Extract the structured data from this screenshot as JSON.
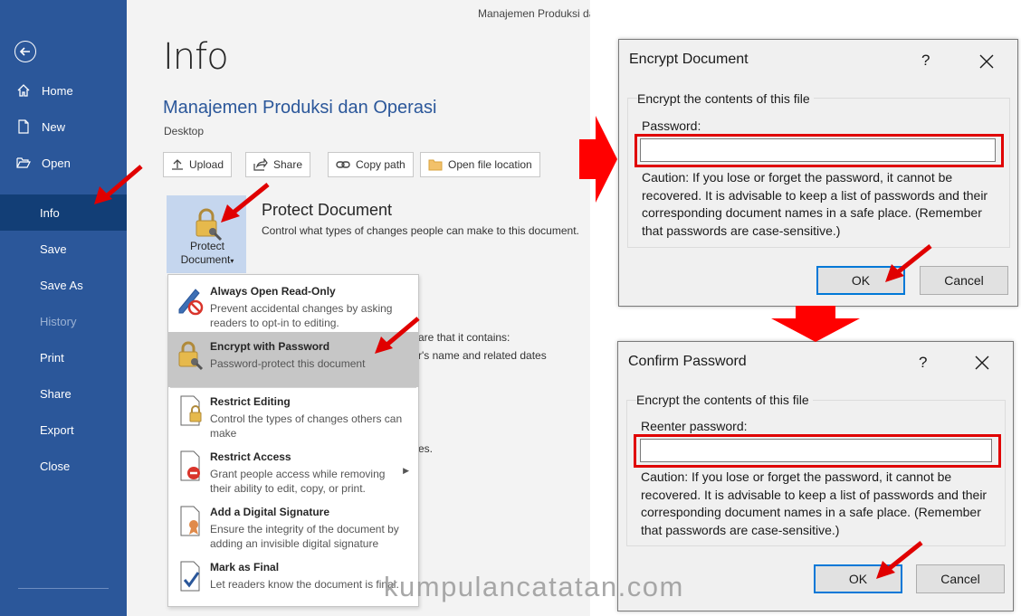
{
  "window": {
    "title": "Manajemen Produksi da"
  },
  "sidebar": {
    "items": [
      {
        "label": "Home",
        "icon": "home-icon"
      },
      {
        "label": "New",
        "icon": "new-document-icon"
      },
      {
        "label": "Open",
        "icon": "folder-open-icon"
      },
      {
        "label": "Info",
        "active": true
      },
      {
        "label": "Save"
      },
      {
        "label": "Save As"
      },
      {
        "label": "History",
        "disabled": true
      },
      {
        "label": "Print"
      },
      {
        "label": "Share"
      },
      {
        "label": "Export"
      },
      {
        "label": "Close"
      }
    ]
  },
  "info": {
    "heading": "Info",
    "doc_name": "Manajemen Produksi dan Operasi",
    "doc_location": "Desktop",
    "actions": [
      "Upload",
      "Share",
      "Copy path",
      "Open file location"
    ],
    "protect": {
      "button_line1": "Protect",
      "button_line2": "Document",
      "title": "Protect Document",
      "description": "Control what types of changes people can make to this document."
    },
    "bg_fragments": [
      "are that it contains:",
      "r's name and related dates",
      "es."
    ]
  },
  "protect_menu": {
    "items": [
      {
        "title": "Always Open Read-Only",
        "desc": "Prevent accidental changes by asking readers to opt-in to editing.",
        "icon": "read-only-pencil-icon"
      },
      {
        "title": "Encrypt with Password",
        "desc": "Password-protect this document",
        "icon": "lock-key-icon",
        "highlighted": true
      },
      {
        "title": "Restrict Editing",
        "desc": "Control the types of changes others can make",
        "icon": "restrict-editing-icon"
      },
      {
        "title": "Restrict Access",
        "desc": "Grant people access while removing their ability to edit, copy, or print.",
        "icon": "restrict-access-icon"
      },
      {
        "title": "Add a Digital Signature",
        "desc": "Ensure the integrity of the document by adding an invisible digital signature",
        "icon": "digital-signature-icon"
      },
      {
        "title": "Mark as Final",
        "desc": "Let readers know the document is final.",
        "icon": "mark-final-icon"
      }
    ]
  },
  "encrypt_dialog": {
    "title": "Encrypt Document",
    "help": "?",
    "group_label": "Encrypt the contents of this file",
    "field_label": "Password:",
    "value": "",
    "caution": "Caution: If you lose or forget the password, it cannot be recovered. It is advisable to keep a list of passwords and their corresponding document names in a safe place. (Remember that passwords are case-sensitive.)",
    "ok": "OK",
    "cancel": "Cancel"
  },
  "confirm_dialog": {
    "title": "Confirm Password",
    "help": "?",
    "group_label": "Encrypt the contents of this file",
    "field_label": "Reenter password:",
    "value": "",
    "caution": "Caution: If you lose or forget the password, it cannot be recovered. It is advisable to keep a list of passwords and their corresponding document names in a safe place. (Remember that passwords are case-sensitive.)",
    "ok": "OK",
    "cancel": "Cancel"
  },
  "watermark": "kumpulancatatan.com",
  "colors": {
    "sidebar": "#2b579a",
    "sidebar_active": "#123e76",
    "annotation_red": "#e00000",
    "accent_blue": "#0078d7"
  }
}
